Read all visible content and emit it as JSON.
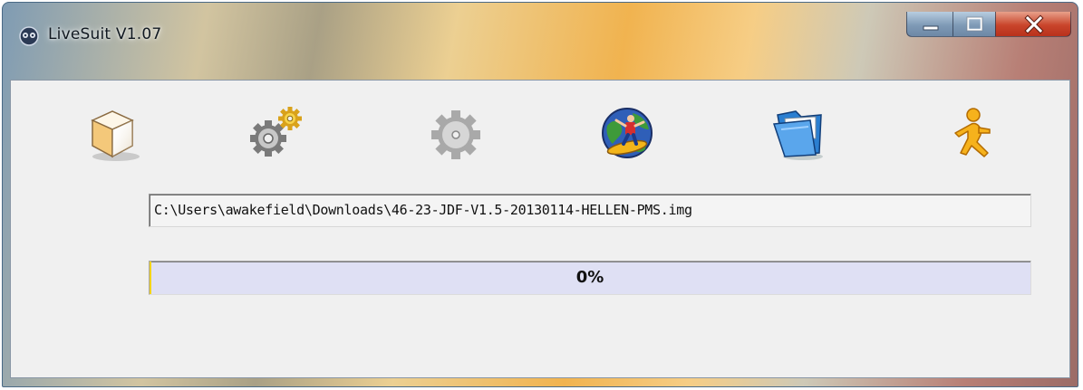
{
  "window": {
    "title": "LiveSuit V1.07",
    "controls": [
      "minimize",
      "maximize",
      "close"
    ]
  },
  "toolbar": {
    "items": [
      {
        "icon": "package-box-icon"
      },
      {
        "icon": "gears-settings-icon"
      },
      {
        "icon": "gear-disabled-icon"
      },
      {
        "icon": "globe-surfer-icon"
      },
      {
        "icon": "open-folder-icon"
      },
      {
        "icon": "running-man-icon"
      }
    ]
  },
  "image_path": {
    "value": "C:\\Users\\awakefield\\Downloads\\46-23-JDF-V1.5-20130114-HELLEN-PMS.img"
  },
  "progress": {
    "value": 0,
    "label": "0%",
    "fill_color": "#f3d41a",
    "track_color": "#dfe0f4"
  }
}
